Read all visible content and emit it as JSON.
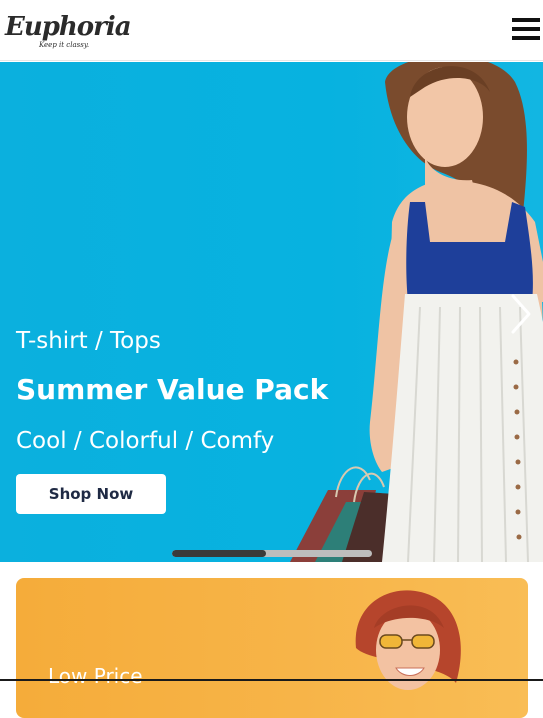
{
  "header": {
    "logo_text": "Euphoria",
    "logo_tagline": "Keep it classy.",
    "menu_icon": "hamburger-menu-icon"
  },
  "hero": {
    "eyebrow": "T-shirt / Tops",
    "title": "Summer Value Pack",
    "subtitle": "Cool / Colorful / Comfy",
    "cta_label": "Shop Now",
    "next_icon": "chevron-right-icon",
    "slider_progress": 0.47,
    "background_color": "#07b2e0"
  },
  "promo": {
    "label": "Low Price",
    "background_color": "#f7b448"
  },
  "colors": {
    "cta_text": "#1f2a44",
    "slider_active": "#3a3a3a",
    "slider_track": "#bdbdbd"
  }
}
